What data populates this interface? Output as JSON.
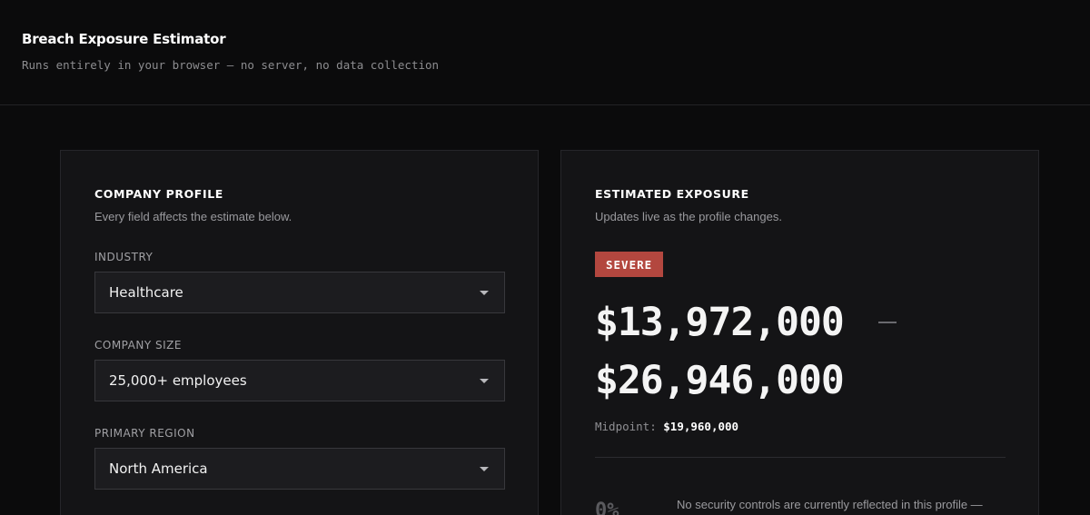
{
  "header": {
    "title": "Breach Exposure Estimator",
    "subtitle": "Runs entirely in your browser — no server, no data collection"
  },
  "profile": {
    "heading": "COMPANY PROFILE",
    "description": "Every field affects the estimate below.",
    "fields": [
      {
        "label": "INDUSTRY",
        "value": "Healthcare"
      },
      {
        "label": "COMPANY SIZE",
        "value": "25,000+ employees"
      },
      {
        "label": "PRIMARY REGION",
        "value": "North America"
      }
    ]
  },
  "exposure": {
    "heading": "ESTIMATED EXPOSURE",
    "description": "Updates live as the profile changes.",
    "severity": "SEVERE",
    "severity_color": "#b3473f",
    "range_low": "$13,972,000",
    "range_high": "$26,946,000",
    "midpoint_label": "Midpoint:",
    "midpoint_value": "$19,960,000",
    "controls_percent": "0%",
    "controls_note": "No security controls are currently reflected in this profile —"
  }
}
